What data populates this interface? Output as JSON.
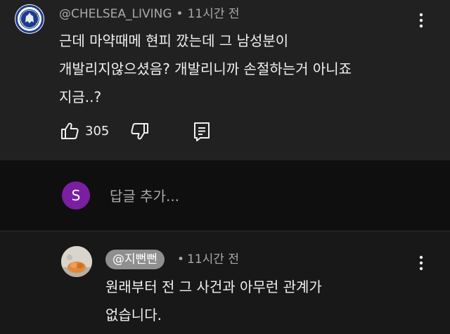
{
  "comment": {
    "author": "@CHELSEA_LIVING",
    "separator": "•",
    "time": "11시간 전",
    "lines": [
      "근데 마약때메 현피 깠는데 그 남성분이",
      "개발리지않으셨음? 개발리니까 손절하는거 아니죠",
      "지금..?"
    ],
    "likes": "305",
    "avatar_icon": "chelsea-crest",
    "icons": [
      "like-icon",
      "dislike-icon",
      "reply-icon",
      "more-vert-icon"
    ]
  },
  "add_reply": {
    "avatar_letter": "S",
    "avatar_color": "#7b1fa2",
    "placeholder": "답글 추가..."
  },
  "reply": {
    "author": "@지뻔뻔",
    "separator": "•",
    "time": "11시간 전",
    "lines": [
      "원래부터 전 그 사건과 아무런 관계가",
      "없습니다."
    ],
    "author_chip_color": "#8f8f8f"
  },
  "colors": {
    "background": "#0f0f0f",
    "comment_panel": "#212121",
    "reply_panel": "#181818",
    "text_primary": "#f1f1f1",
    "text_secondary": "#aaaaaa"
  }
}
